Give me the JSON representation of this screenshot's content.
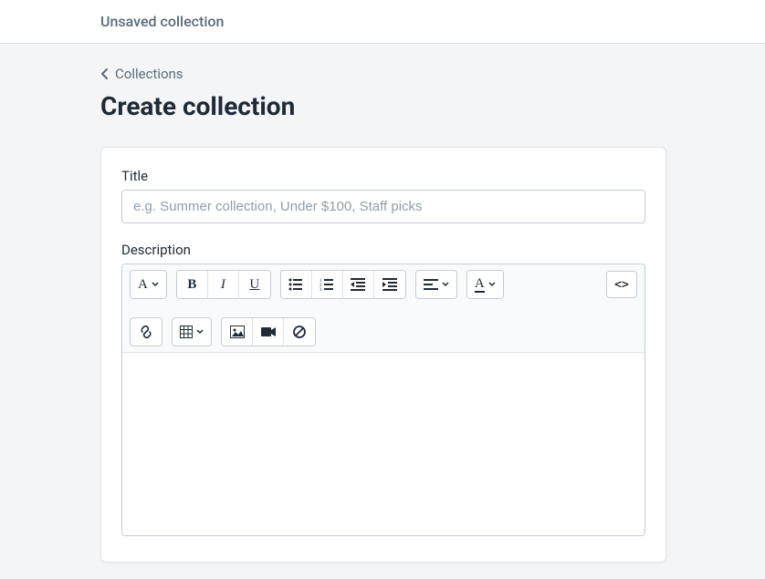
{
  "header": {
    "status": "Unsaved collection"
  },
  "breadcrumb": {
    "label": "Collections"
  },
  "page": {
    "title": "Create collection"
  },
  "form": {
    "title_label": "Title",
    "title_placeholder": "e.g. Summer collection, Under $100, Staff picks",
    "title_value": "",
    "description_label": "Description",
    "description_value": ""
  },
  "toolbar": {
    "font_label": "A",
    "bold_label": "B",
    "italic_label": "I",
    "underline_label": "U",
    "textcolor_label": "A",
    "code_label": "<>"
  }
}
